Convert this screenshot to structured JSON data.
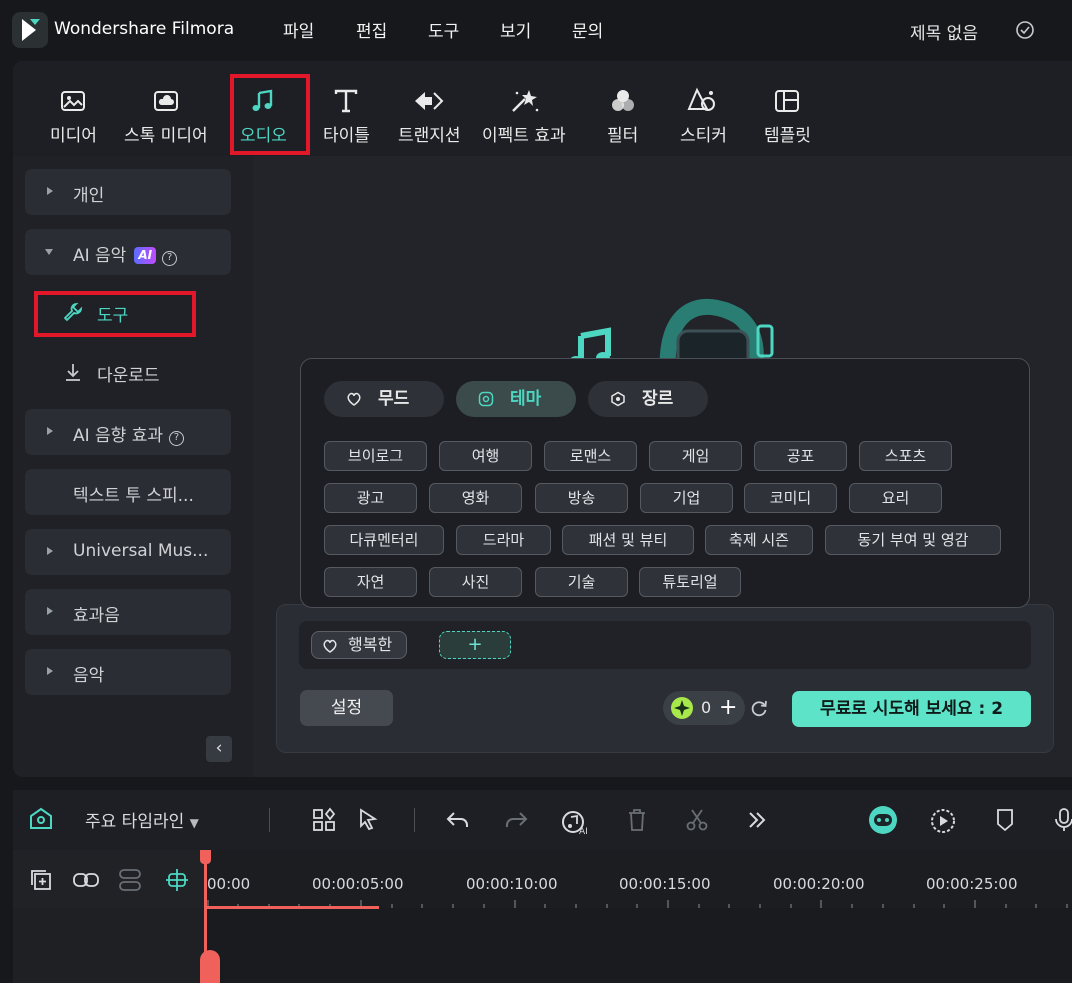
{
  "app": {
    "name": "Wondershare Filmora",
    "menu": [
      "파일",
      "편집",
      "도구",
      "보기",
      "문의"
    ],
    "project_title": "제목 없음"
  },
  "toolbar": {
    "tabs": [
      {
        "label": "미디어",
        "icon": "media-icon"
      },
      {
        "label": "스톡 미디어",
        "icon": "cloud-folder-icon"
      },
      {
        "label": "오디오",
        "icon": "music-note-icon",
        "active": true
      },
      {
        "label": "타이틀",
        "icon": "text-icon"
      },
      {
        "label": "트랜지션",
        "icon": "transition-icon"
      },
      {
        "label": "이펙트 효과",
        "icon": "sparkle-icon"
      },
      {
        "label": "필터",
        "icon": "filter-icon"
      },
      {
        "label": "스티커",
        "icon": "sticker-icon"
      },
      {
        "label": "템플릿",
        "icon": "template-icon"
      }
    ]
  },
  "sidebar": {
    "items": [
      {
        "label": "개인"
      },
      {
        "label": "AI 음악",
        "badge": "AI"
      },
      {
        "label": "AI 음향 효과"
      },
      {
        "label": "텍스트 투 스피..."
      },
      {
        "label": "Universal Mus..."
      },
      {
        "label": "효과음"
      },
      {
        "label": "음악"
      }
    ],
    "sub_items": [
      "도구",
      "다운로드"
    ]
  },
  "popup": {
    "tabs": [
      "무드",
      "테마",
      "장르"
    ],
    "active_tab": "테마",
    "tags": [
      "브이로그",
      "여행",
      "로맨스",
      "게임",
      "공포",
      "스포츠",
      "광고",
      "영화",
      "방송",
      "기업",
      "코미디",
      "요리",
      "다큐멘터리",
      "드라마",
      "패션 및 뷰티",
      "축제 시즌",
      "동기 부여 및 영감",
      "자연",
      "사진",
      "기술",
      "튜토리얼"
    ]
  },
  "generator": {
    "selected_tag": "행복한",
    "add_label": "+",
    "settings_label": "설정",
    "credits": "0",
    "try_label": "무료로 시도해 보세요 : 2"
  },
  "timeline": {
    "label": "주요 타임라인",
    "timecodes": [
      "00:00",
      "00:00:05:00",
      "00:00:10:00",
      "00:00:15:00",
      "00:00:20:00",
      "00:00:25:00"
    ]
  },
  "colors": {
    "accent": "#4dd7c2",
    "highlight": "#e3172a",
    "playhead": "#f0615c",
    "try_button": "#5de3c8"
  }
}
